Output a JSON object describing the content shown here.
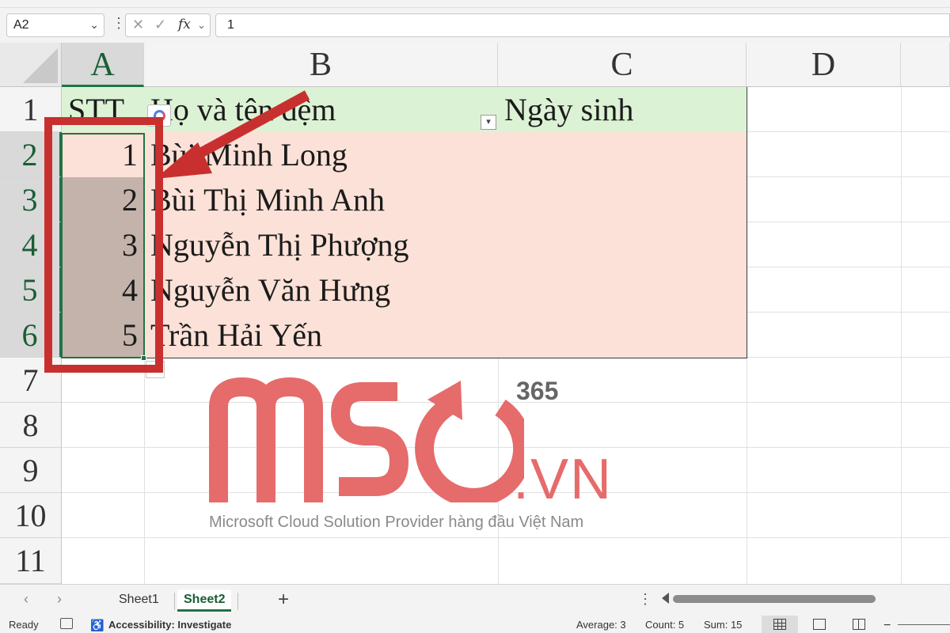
{
  "formula_bar": {
    "name_box": "A2",
    "dots": "⋮",
    "cancel_glyph": "✕",
    "enter_glyph": "✓",
    "fx_label": "fx",
    "formula_value": "1"
  },
  "columns": [
    "A",
    "B",
    "C",
    "D"
  ],
  "rows": [
    "1",
    "2",
    "3",
    "4",
    "5",
    "6",
    "7",
    "8",
    "9",
    "10",
    "11"
  ],
  "table": {
    "headers": [
      "STT",
      "Họ và tên đệm",
      "Ngày sinh"
    ],
    "rows": [
      {
        "stt": "1",
        "name": "Bùi Minh Long",
        "dob": ""
      },
      {
        "stt": "2",
        "name": "Bùi Thị Minh Anh",
        "dob": ""
      },
      {
        "stt": "3",
        "name": "Nguyễn Thị Phượng",
        "dob": ""
      },
      {
        "stt": "4",
        "name": "Nguyễn Văn Hưng",
        "dob": ""
      },
      {
        "stt": "5",
        "name": "Trần Hải Yến",
        "dob": ""
      }
    ]
  },
  "watermark": {
    "logo_text": "MSO",
    "superscript": "365",
    "domain": ".VN",
    "tagline": "Microsoft Cloud Solution Provider hàng đầu Việt Nam"
  },
  "sheet_tabs": {
    "prev": "‹",
    "next": "›",
    "tabs": [
      "Sheet1",
      "Sheet2"
    ],
    "active": "Sheet2",
    "add": "+"
  },
  "status_bar": {
    "ready": "Ready",
    "accessibility": "Accessibility: Investigate",
    "average": "Average: 3",
    "count": "Count: 5",
    "sum": "Sum: 15",
    "zoom_minus": "−"
  },
  "colors": {
    "excel_green": "#217346",
    "header_fill": "#dcf2d5",
    "body_fill": "#fbe1d7",
    "selected_fill": "#c4b3aa",
    "annotation_red": "#c8302f",
    "watermark_red": "#e66b6b"
  }
}
